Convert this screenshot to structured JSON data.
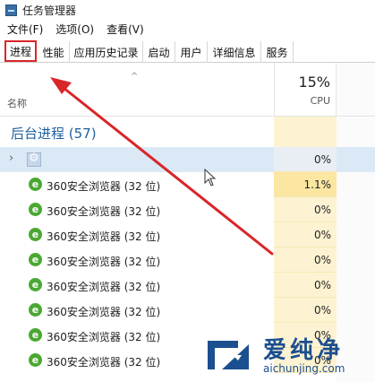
{
  "window": {
    "title": "任务管理器"
  },
  "menu": [
    "文件(F)",
    "选项(O)",
    "查看(V)"
  ],
  "tabs": [
    {
      "label": "进程",
      "active": true
    },
    {
      "label": "性能",
      "active": false
    },
    {
      "label": "应用历史记录",
      "active": false
    },
    {
      "label": "启动",
      "active": false
    },
    {
      "label": "用户",
      "active": false
    },
    {
      "label": "详细信息",
      "active": false
    },
    {
      "label": "服务",
      "active": false
    }
  ],
  "header": {
    "sort_indicator": "^",
    "name_col": "名称",
    "cpu_percent": "15%",
    "cpu_label": "CPU"
  },
  "group": {
    "title": "后台进程 (57)"
  },
  "rows": [
    {
      "name": "",
      "cpu": "0%",
      "expandable": true,
      "icon": "gear-icon",
      "selected": true
    },
    {
      "name": "360安全浏览器 (32 位)",
      "cpu": "1.1%",
      "icon": "browser-icon",
      "hot": true
    },
    {
      "name": "360安全浏览器 (32 位)",
      "cpu": "0%",
      "icon": "browser-icon"
    },
    {
      "name": "360安全浏览器 (32 位)",
      "cpu": "0%",
      "icon": "browser-icon"
    },
    {
      "name": "360安全浏览器 (32 位)",
      "cpu": "0%",
      "icon": "browser-icon"
    },
    {
      "name": "360安全浏览器 (32 位)",
      "cpu": "0%",
      "icon": "browser-icon"
    },
    {
      "name": "360安全浏览器 (32 位)",
      "cpu": "0%",
      "icon": "browser-icon"
    },
    {
      "name": "360安全浏览器 (32 位)",
      "cpu": "0%",
      "icon": "browser-icon"
    },
    {
      "name": "360安全浏览器 (32 位)",
      "cpu": "0%",
      "icon": "browser-icon"
    }
  ],
  "watermark": {
    "brand": "爱纯净",
    "url": "aichunjing.com"
  },
  "colors": {
    "accent_red": "#d9262a",
    "group_blue": "#1f5f9f",
    "cpu_cell": "#fdf3d2"
  }
}
